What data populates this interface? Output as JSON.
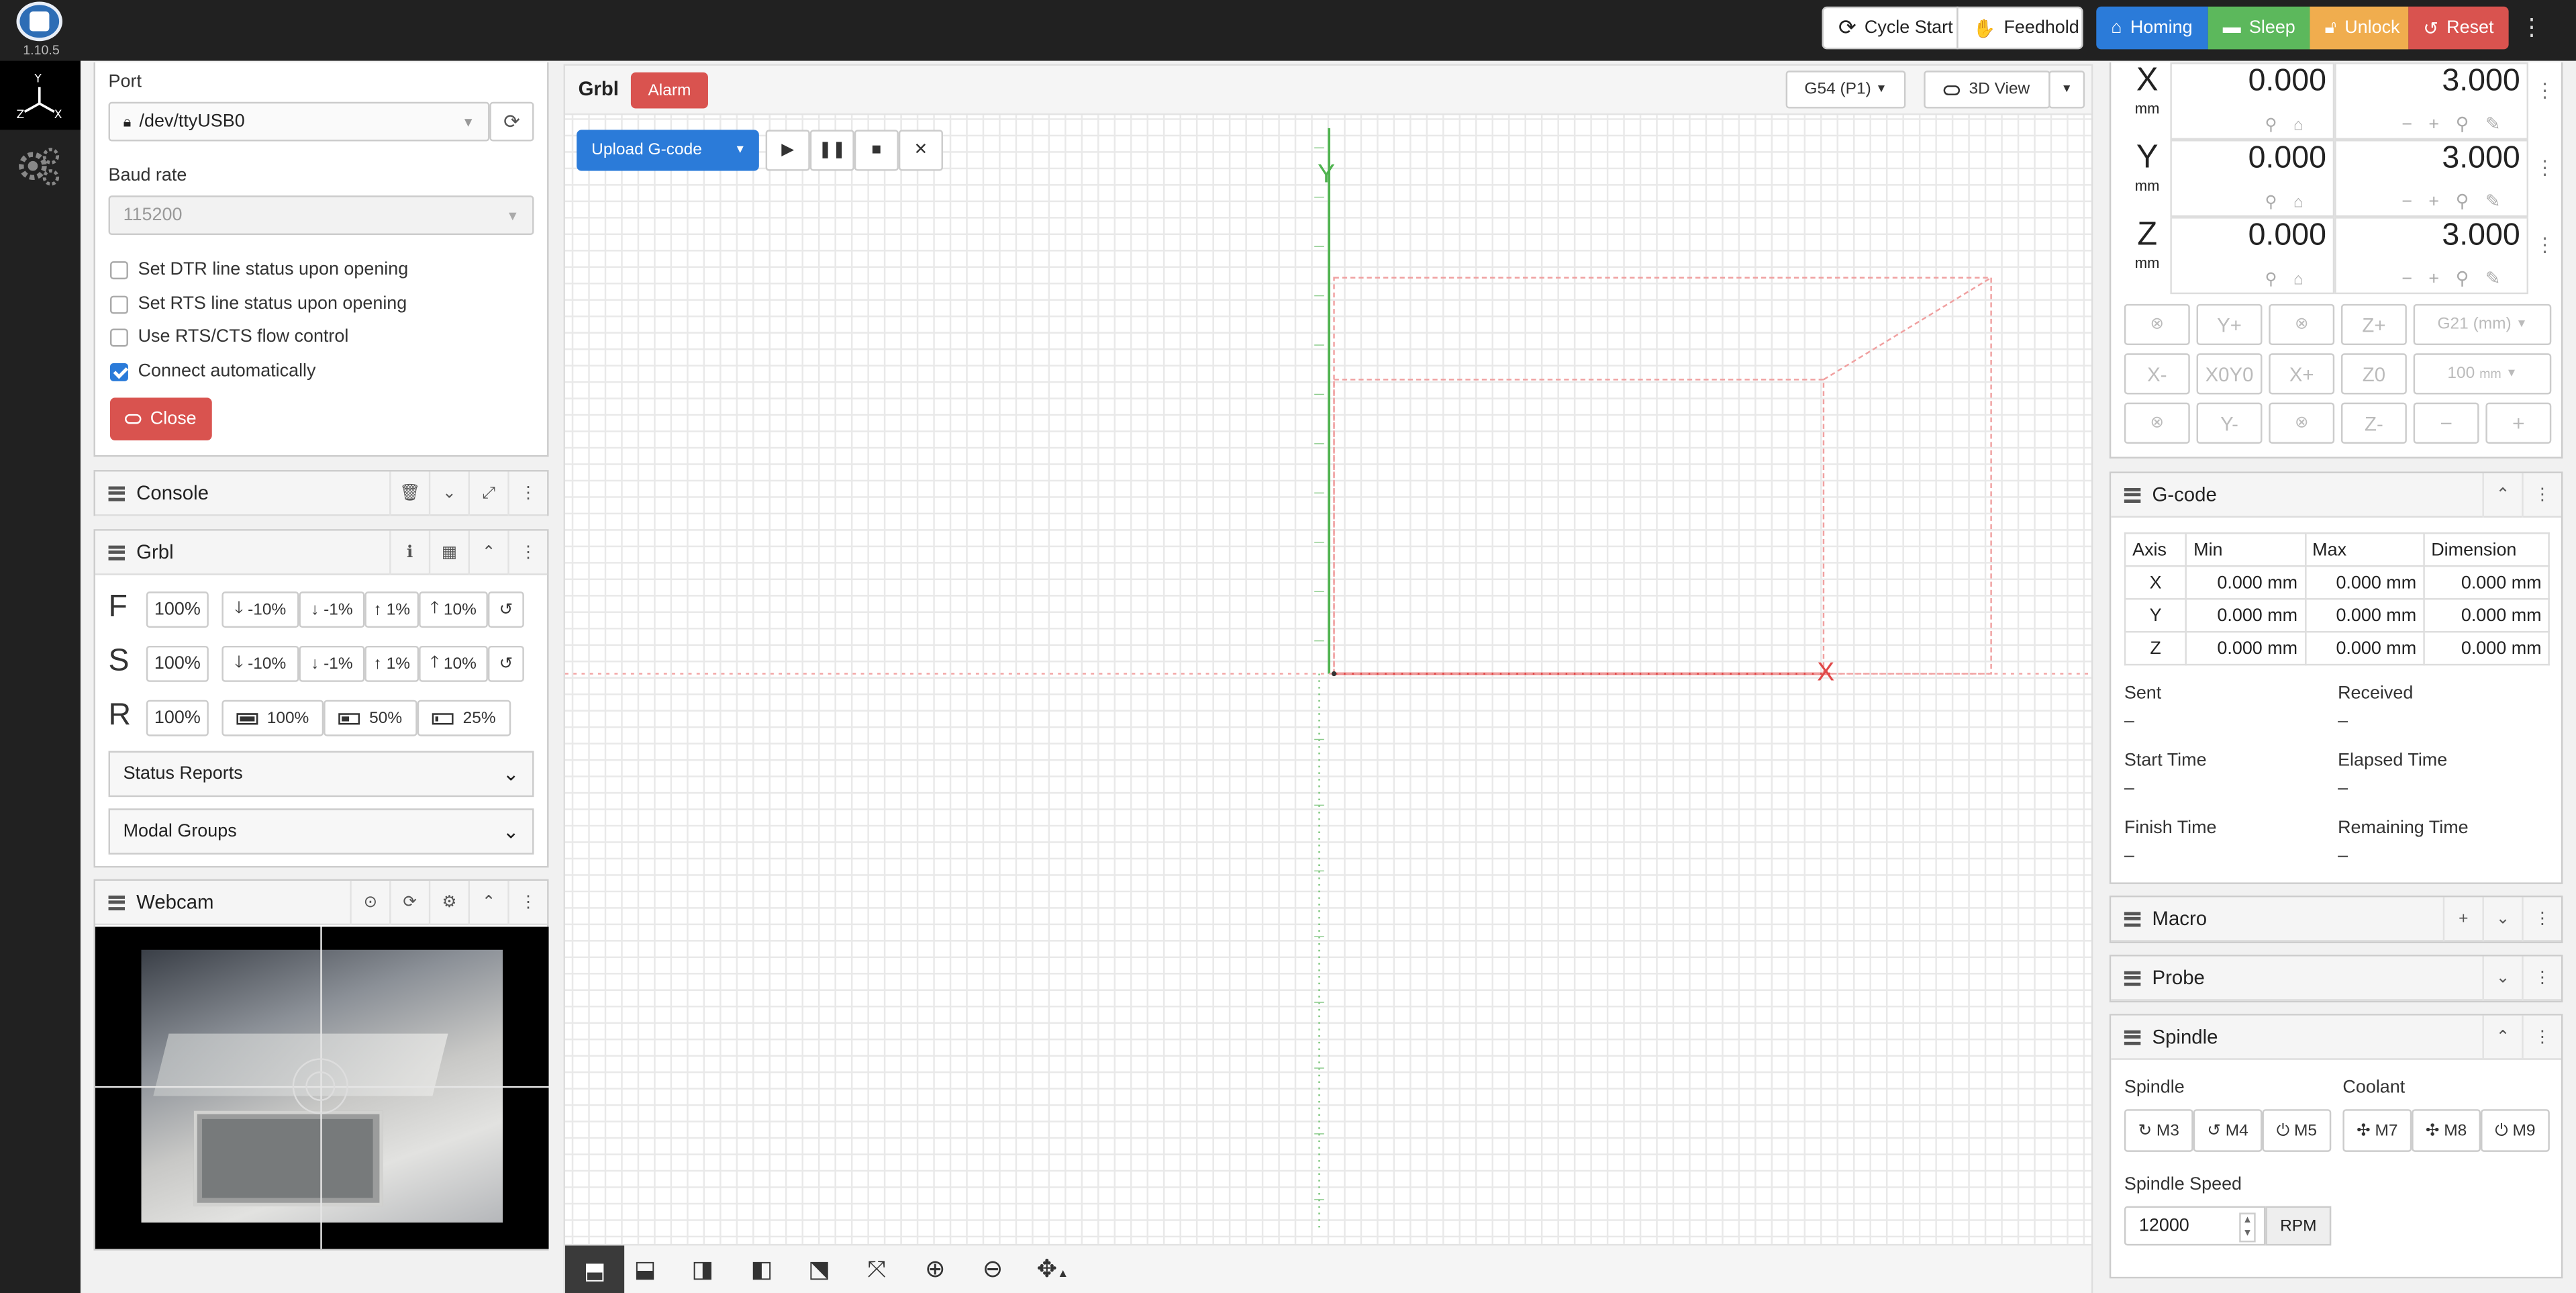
{
  "app": {
    "version": "1.10.5"
  },
  "toolbar": {
    "cycle_start": "Cycle Start",
    "feedhold": "Feedhold",
    "homing": "Homing",
    "sleep": "Sleep",
    "unlock": "Unlock",
    "reset": "Reset"
  },
  "connection": {
    "port_label": "Port",
    "port_value": "/dev/ttyUSB0",
    "baud_label": "Baud rate",
    "baud_value": "115200",
    "options": [
      {
        "label": "Set DTR line status upon opening",
        "checked": false
      },
      {
        "label": "Set RTS line status upon opening",
        "checked": false
      },
      {
        "label": "Use RTS/CTS flow control",
        "checked": false
      },
      {
        "label": "Connect automatically",
        "checked": true
      }
    ],
    "close_label": "Close"
  },
  "console": {
    "title": "Console"
  },
  "grbl": {
    "title": "Grbl",
    "f": {
      "letter": "F",
      "value": "100%",
      "buttons": [
        "-10%",
        "-1%",
        "1%",
        "10%"
      ]
    },
    "s": {
      "letter": "S",
      "value": "100%",
      "buttons": [
        "-10%",
        "-1%",
        "1%",
        "10%"
      ]
    },
    "r": {
      "letter": "R",
      "value": "100%",
      "buttons": [
        "100%",
        "50%",
        "25%"
      ]
    },
    "status_reports": "Status Reports",
    "modal_groups": "Modal Groups"
  },
  "webcam": {
    "title": "Webcam"
  },
  "visualizer": {
    "title": "Grbl",
    "state": "Alarm",
    "wcs": "G54 (P1)",
    "view_mode": "3D View",
    "upload_label": "Upload G-code",
    "y_axis": "Y",
    "x_axis": "X"
  },
  "dro": {
    "axes": [
      {
        "name": "X",
        "unit": "mm",
        "work": "0.000",
        "machine": "3.000"
      },
      {
        "name": "Y",
        "unit": "mm",
        "work": "0.000",
        "machine": "3.000"
      },
      {
        "name": "Z",
        "unit": "mm",
        "work": "0.000",
        "machine": "3.000"
      }
    ],
    "jog": {
      "row1": [
        "",
        "Y+",
        "",
        "Z+"
      ],
      "row2": [
        "X-",
        "X0Y0",
        "X+",
        "Z0"
      ],
      "row3": [
        "",
        "Y-",
        "",
        "Z-"
      ],
      "units": "G21 (mm)",
      "distance": "100",
      "distance_unit": "mm"
    }
  },
  "gcode": {
    "title": "G-code",
    "headers": [
      "Axis",
      "Min",
      "Max",
      "Dimension"
    ],
    "rows": [
      [
        "X",
        "0.000 mm",
        "0.000 mm",
        "0.000 mm"
      ],
      [
        "Y",
        "0.000 mm",
        "0.000 mm",
        "0.000 mm"
      ],
      [
        "Z",
        "0.000 mm",
        "0.000 mm",
        "0.000 mm"
      ]
    ],
    "stats": {
      "sent_label": "Sent",
      "sent": "–",
      "received_label": "Received",
      "received": "–",
      "start_label": "Start Time",
      "start": "–",
      "elapsed_label": "Elapsed Time",
      "elapsed": "–",
      "finish_label": "Finish Time",
      "finish": "–",
      "remaining_label": "Remaining Time",
      "remaining": "–"
    }
  },
  "macro": {
    "title": "Macro"
  },
  "probe": {
    "title": "Probe"
  },
  "spindle": {
    "title": "Spindle",
    "spindle_label": "Spindle",
    "coolant_label": "Coolant",
    "m3": "M3",
    "m4": "M4",
    "m5": "M5",
    "m7": "M7",
    "m8": "M8",
    "m9": "M9",
    "speed_label": "Spindle Speed",
    "speed": "12000",
    "rpm": "RPM"
  },
  "colors": {
    "blue": "#2b7bd9",
    "green": "#5cb85c",
    "orange": "#f0ad4e",
    "red": "#d9534f",
    "dark": "#212121"
  }
}
